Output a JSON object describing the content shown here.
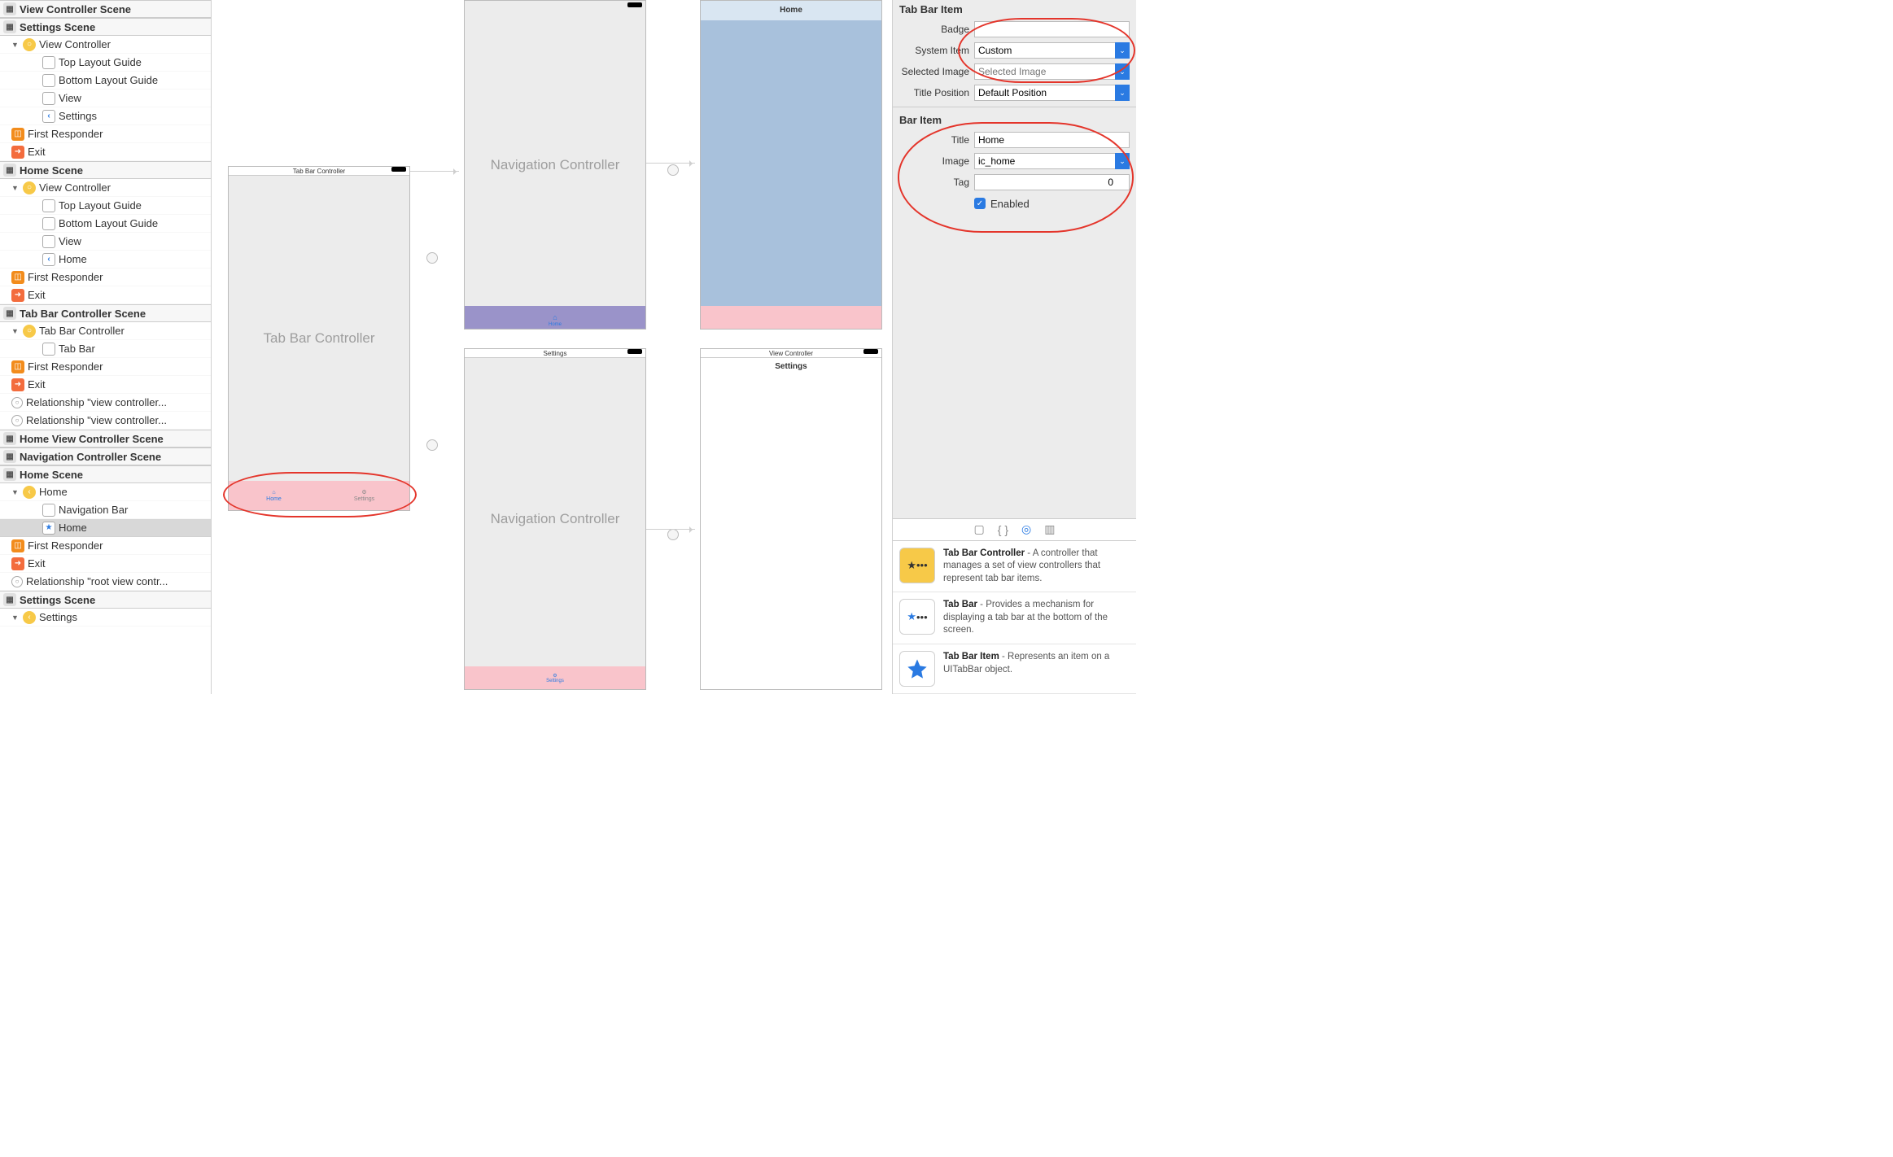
{
  "outline": {
    "vcs_header": "View Controller Scene",
    "settings_scene": "Settings Scene",
    "view_controller": "View Controller",
    "top_layout": "Top Layout Guide",
    "bottom_layout": "Bottom Layout Guide",
    "view": "View",
    "settings": "Settings",
    "first_responder": "First Responder",
    "exit": "Exit",
    "home_scene": "Home Scene",
    "home": "Home",
    "tabbar_controller_scene": "Tab Bar Controller Scene",
    "tabbar_controller": "Tab Bar Controller",
    "tabbar": "Tab Bar",
    "rel_vc": "Relationship \"view controller...",
    "home_vc_scene": "Home View Controller Scene",
    "nav_controller_scene": "Navigation Controller Scene",
    "home_scene2": "Home Scene",
    "navigation_bar": "Navigation Bar",
    "rel_root": "Relationship \"root view contr...",
    "settings_scene2": "Settings Scene",
    "settings2": "Settings"
  },
  "canvas": {
    "tabbar_title": "Tab Bar Controller",
    "tabbar_center": "Tab Bar Controller",
    "tab_home": "Home",
    "tab_settings": "Settings",
    "nav_ctrl": "Navigation Controller",
    "settings_title": "Settings",
    "home_title": "Home",
    "vc_title": "View Controller"
  },
  "inspector": {
    "tabbar_item_section": "Tab Bar Item",
    "badge_label": "Badge",
    "badge_value": "",
    "system_item_label": "System Item",
    "system_item_value": "Custom",
    "selected_image_label": "Selected Image",
    "selected_image_placeholder": "Selected Image",
    "title_position_label": "Title Position",
    "title_position_value": "Default Position",
    "bar_item_section": "Bar Item",
    "title_label": "Title",
    "title_value": "Home",
    "image_label": "Image",
    "image_value": "ic_home",
    "tag_label": "Tag",
    "tag_value": "0",
    "enabled_label": "Enabled"
  },
  "library": {
    "items": [
      {
        "title": "Tab Bar Controller",
        "desc": " - A controller that manages a set of view controllers that represent tab bar items."
      },
      {
        "title": "Tab Bar",
        "desc": " - Provides a mechanism for displaying a tab bar at the bottom of the screen."
      },
      {
        "title": "Tab Bar Item",
        "desc": " - Represents an item on a UITabBar object."
      }
    ]
  }
}
